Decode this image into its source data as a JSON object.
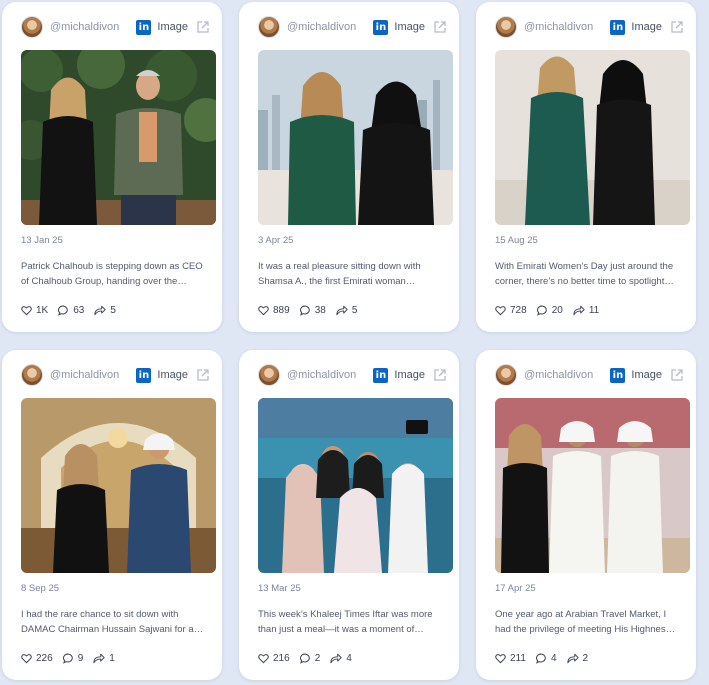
{
  "cards": [
    {
      "handle": "@michaldivon",
      "platform": "linkedin",
      "type": "Image",
      "date": "13 Jan 25",
      "text": "Patrick Chalhoub is stepping down as CEO of Chalhoub Group, handing over the…",
      "likes": "1K",
      "comments": "63",
      "shares": "5"
    },
    {
      "handle": "@michaldivon",
      "platform": "linkedin",
      "type": "Image",
      "date": "3 Apr 25",
      "text": "It was a real pleasure sitting down with Shamsa A., the first Emirati woman…",
      "likes": "889",
      "comments": "38",
      "shares": "5"
    },
    {
      "handle": "@michaldivon",
      "platform": "linkedin",
      "type": "Image",
      "date": "15 Aug 25",
      "text": "With Emirati Women’s Day just around the corner, there’s no better time to spotlight…",
      "likes": "728",
      "comments": "20",
      "shares": "11"
    },
    {
      "handle": "@michaldivon",
      "platform": "linkedin",
      "type": "Image",
      "date": "8 Sep 25",
      "text": "I had the rare chance to sit down with DAMAC Chairman Hussain Sajwani for a…",
      "likes": "226",
      "comments": "9",
      "shares": "1"
    },
    {
      "handle": "@michaldivon",
      "platform": "linkedin",
      "type": "Image",
      "date": "13 Mar 25",
      "text": "This week’s Khaleej Times Iftar was more than just a meal—it was a moment of…",
      "likes": "216",
      "comments": "2",
      "shares": "4"
    },
    {
      "handle": "@michaldivon",
      "platform": "linkedin",
      "type": "Image",
      "date": "17 Apr 25",
      "text": "One year ago at Arabian Travel Market, I had the privilege of meeting His Highnes…",
      "likes": "211",
      "comments": "4",
      "shares": "2"
    }
  ],
  "icons": {
    "linkedin": "linkedin-icon",
    "external": "external-link-icon",
    "like": "heart-icon",
    "comment": "comment-icon",
    "share": "share-icon"
  },
  "colors": {
    "linkedin": "#0a66c2",
    "background": "#dfe6f4"
  }
}
